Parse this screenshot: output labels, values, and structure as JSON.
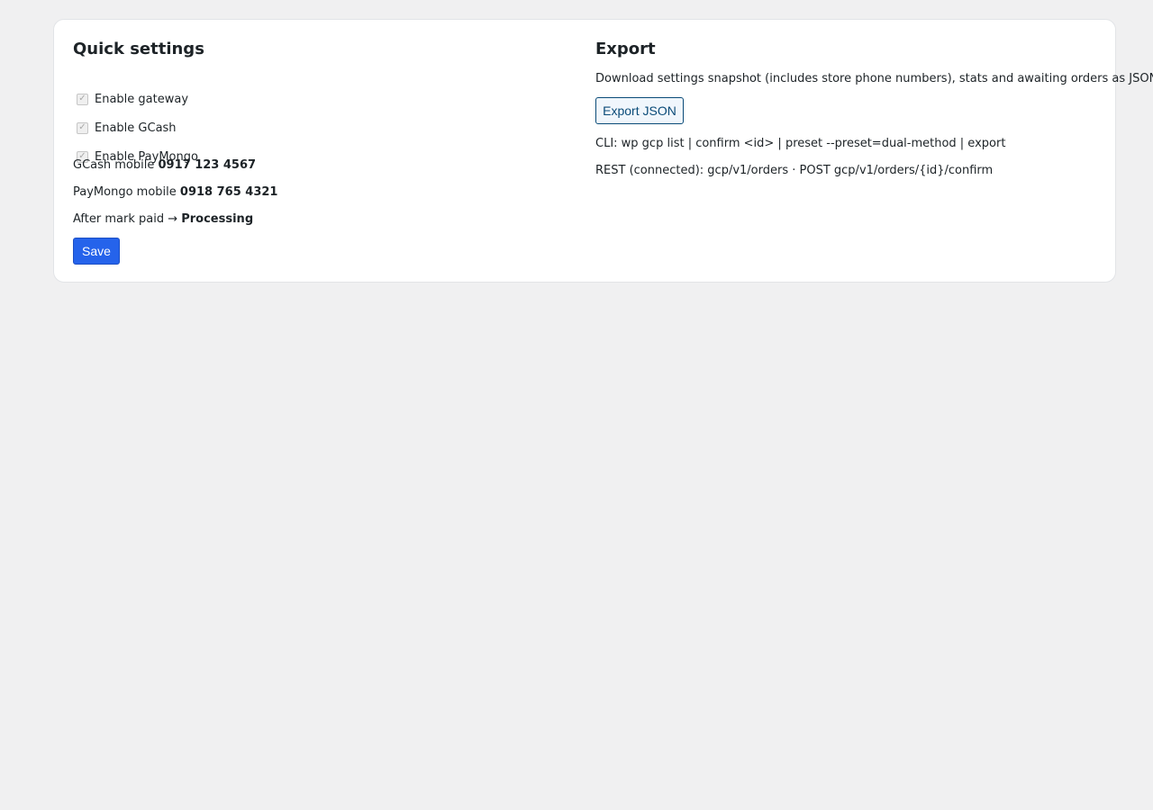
{
  "quick_settings": {
    "title": "Quick settings",
    "toggles": [
      {
        "label": "Enable gateway",
        "checked": true,
        "disabled": true
      },
      {
        "label": "Enable GCash",
        "checked": true,
        "disabled": true
      },
      {
        "label": "Enable PayMongo",
        "checked": true,
        "disabled": true
      }
    ],
    "gcash_mobile": {
      "label": "GCash mobile",
      "value": "0917 123 4567"
    },
    "paymongo_mobile": {
      "label": "PayMongo mobile",
      "value": "0918 765 4321"
    },
    "after_mark_paid": {
      "label": "After mark paid →",
      "value": "Processing"
    },
    "save_label": "Save"
  },
  "export": {
    "title": "Export",
    "description": "Download settings snapshot (includes store phone numbers), stats and awaiting orders as JSON.",
    "button_label": "Export JSON",
    "cli_text": "CLI: wp gcp list | confirm <id> | preset --preset=dual-method | export",
    "rest_text": "REST (connected): gcp/v1/orders · POST gcp/v1/orders/{id}/confirm"
  },
  "colors": {
    "background": "#f0f0f1",
    "card": "#ffffff",
    "primary_button": "#2563eb",
    "secondary_button_text": "#0a4b78"
  }
}
